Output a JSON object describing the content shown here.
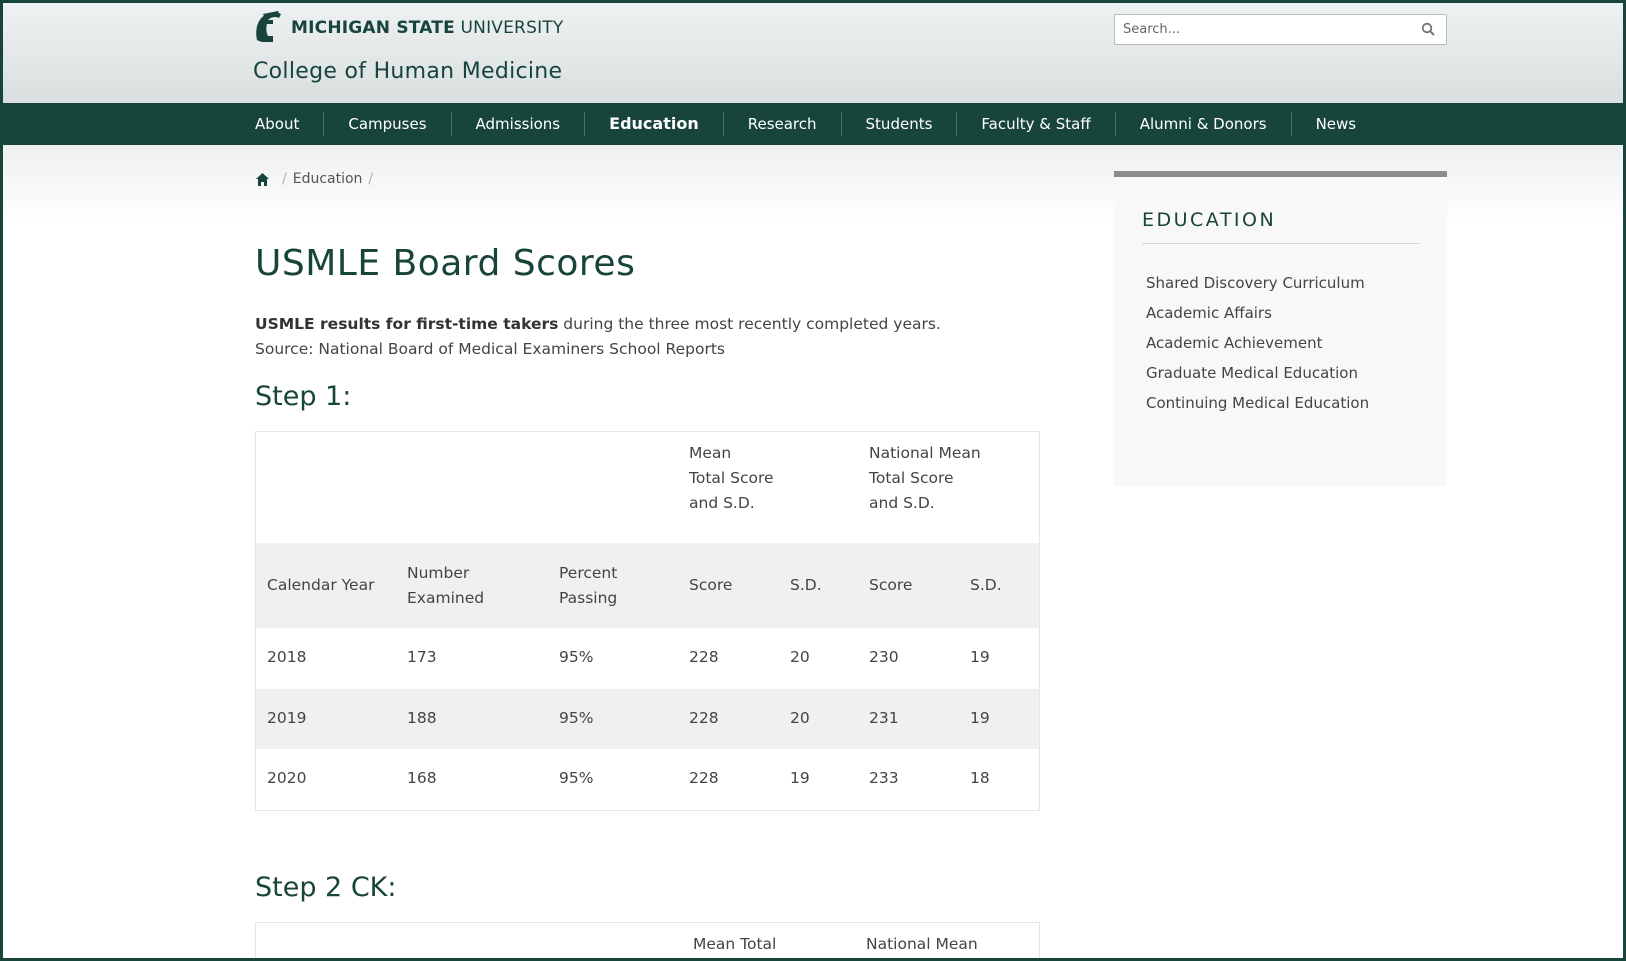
{
  "header": {
    "university_bold": "MICHIGAN STATE",
    "university_light": "UNIVERSITY",
    "college": "College of Human Medicine",
    "search_placeholder": "Search..."
  },
  "nav": {
    "items": [
      {
        "label": "About"
      },
      {
        "label": "Campuses"
      },
      {
        "label": "Admissions"
      },
      {
        "label": "Education",
        "active": true
      },
      {
        "label": "Research"
      },
      {
        "label": "Students"
      },
      {
        "label": "Faculty & Staff"
      },
      {
        "label": "Alumni & Donors"
      },
      {
        "label": "News"
      }
    ]
  },
  "breadcrumb": {
    "items": [
      "Education"
    ]
  },
  "main": {
    "title": "USMLE Board Scores",
    "intro_bold": "USMLE results for first-time takers",
    "intro_rest": " during the three most recently completed years.",
    "intro_source": "Source: National Board of Medical Examiners School Reports",
    "step1": {
      "title": "Step 1:",
      "group_headers": {
        "mean": [
          "Mean",
          "Total Score",
          "and S.D."
        ],
        "national": [
          "National Mean",
          "Total Score",
          "and S.D."
        ]
      },
      "columns": [
        [
          "Calendar Year"
        ],
        [
          "Number",
          "Examined"
        ],
        [
          "Percent",
          "Passing"
        ],
        [
          "Score"
        ],
        [
          "S.D."
        ],
        [
          "Score"
        ],
        [
          "S.D."
        ]
      ],
      "rows": [
        [
          "2018",
          "173",
          "95%",
          "228",
          "20",
          "230",
          "19"
        ],
        [
          "2019",
          "188",
          "95%",
          "228",
          "20",
          "231",
          "19"
        ],
        [
          "2020",
          "168",
          "95%",
          "228",
          "19",
          "233",
          "18"
        ]
      ]
    },
    "step2": {
      "title": "Step 2 CK:",
      "group_headers": {
        "mean": [
          "Mean Total"
        ],
        "national": [
          "National Mean"
        ]
      }
    }
  },
  "sidebar": {
    "title": "EDUCATION",
    "links": [
      "Shared Discovery Curriculum",
      "Academic Affairs",
      "Academic Achievement",
      "Graduate Medical Education",
      "Continuing Medical Education"
    ]
  }
}
